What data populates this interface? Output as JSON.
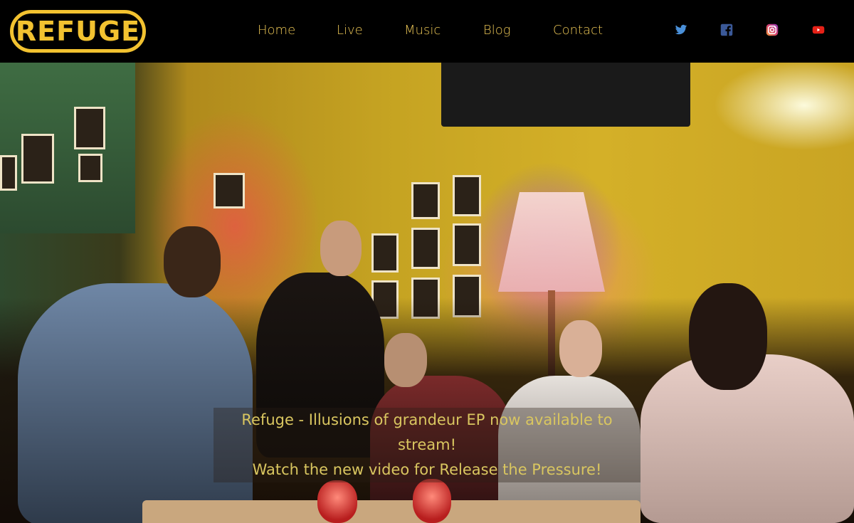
{
  "logo": {
    "text": "REFUGE"
  },
  "nav": [
    {
      "label": "Home"
    },
    {
      "label": "Live"
    },
    {
      "label": "Music"
    },
    {
      "label": "Blog"
    },
    {
      "label": "Contact"
    }
  ],
  "social": [
    {
      "icon": "twitter-icon",
      "color": "#4a90d9"
    },
    {
      "icon": "facebook-icon",
      "color": "#3b5998"
    },
    {
      "icon": "instagram-icon",
      "color": "#d6406e"
    },
    {
      "icon": "youtube-icon",
      "color": "#e62117"
    }
  ],
  "hero": {
    "caption_line1": "Refuge - Illusions of grandeur EP now available to stream!",
    "caption_line2": "Watch the new video for Release the Pressure!"
  },
  "colors": {
    "accent": "#f2c230",
    "nav_text": "#e9c455",
    "background": "#000000"
  }
}
